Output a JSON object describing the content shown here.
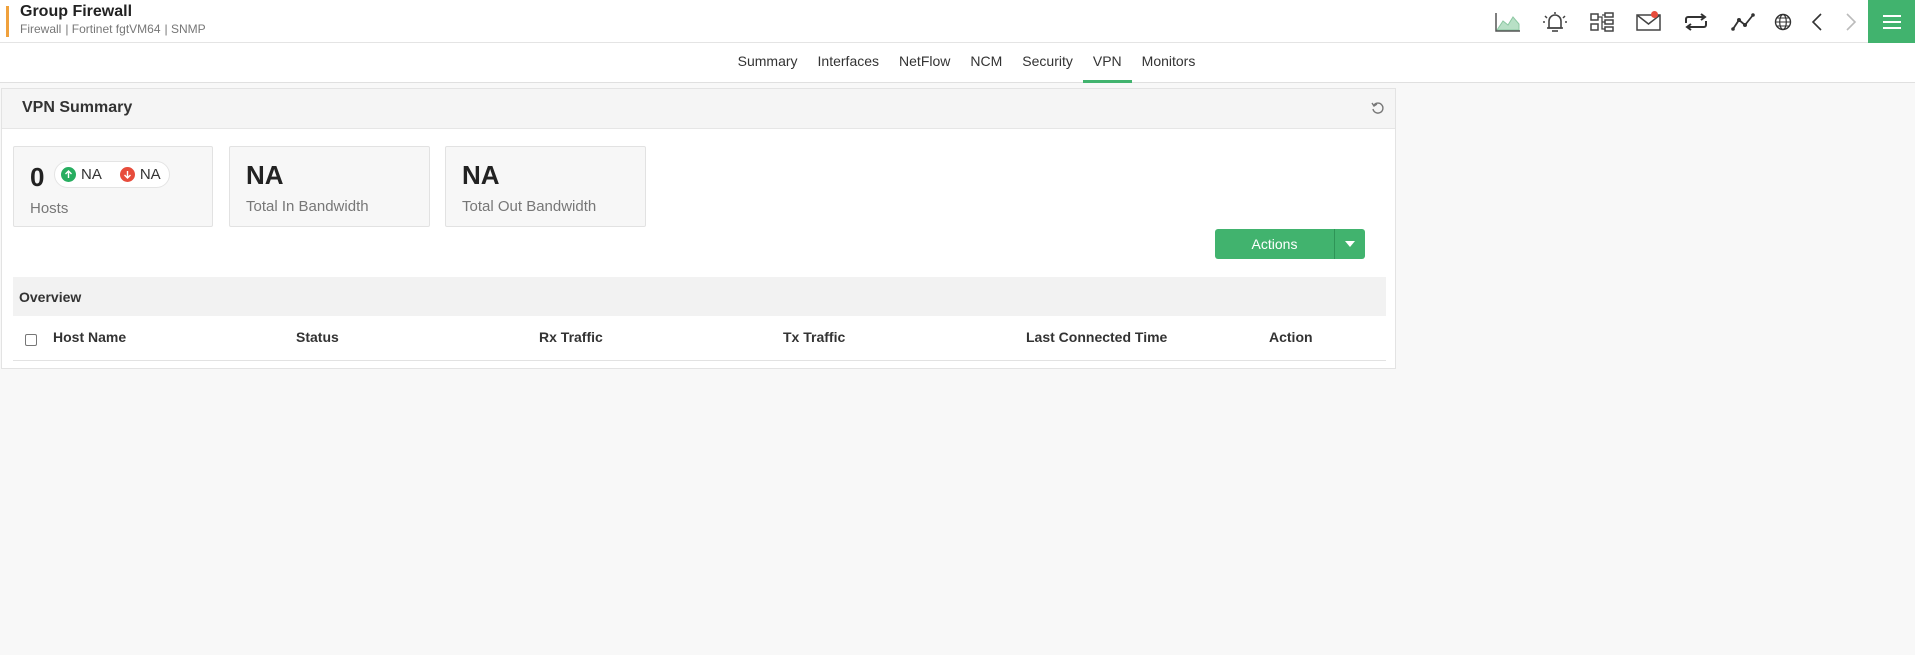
{
  "header": {
    "title": "Group Firewall",
    "subtitle_parts": [
      "Firewall",
      "| Fortinet fgtVM64",
      "| SNMP"
    ]
  },
  "toolbar": {
    "icons": [
      "area-chart-icon",
      "alarm-bell-icon",
      "topology-icon",
      "mail-icon",
      "sync-icon",
      "line-graph-icon",
      "globe-icon",
      "chevron-left-icon",
      "chevron-right-icon"
    ],
    "menu_icon": "hamburger-menu-icon"
  },
  "tabs": [
    {
      "label": "Summary",
      "active": false
    },
    {
      "label": "Interfaces",
      "active": false
    },
    {
      "label": "NetFlow",
      "active": false
    },
    {
      "label": "NCM",
      "active": false
    },
    {
      "label": "Security",
      "active": false
    },
    {
      "label": "VPN",
      "active": true
    },
    {
      "label": "Monitors",
      "active": false
    }
  ],
  "vpn_summary": {
    "title": "VPN Summary",
    "hosts": {
      "count": "0",
      "up": "NA",
      "down": "NA",
      "label": "Hosts"
    },
    "in_bandwidth": {
      "value": "NA",
      "label": "Total In Bandwidth"
    },
    "out_bandwidth": {
      "value": "NA",
      "label": "Total Out Bandwidth"
    },
    "actions_label": "Actions"
  },
  "overview": {
    "title": "Overview",
    "columns": [
      "Host Name",
      "Status",
      "Rx Traffic",
      "Tx Traffic",
      "Last Connected Time",
      "Action"
    ]
  },
  "colors": {
    "accent": "#41b36e",
    "brand_bar": "#f0a13c",
    "up": "#27ae60",
    "down": "#e74c3c"
  }
}
